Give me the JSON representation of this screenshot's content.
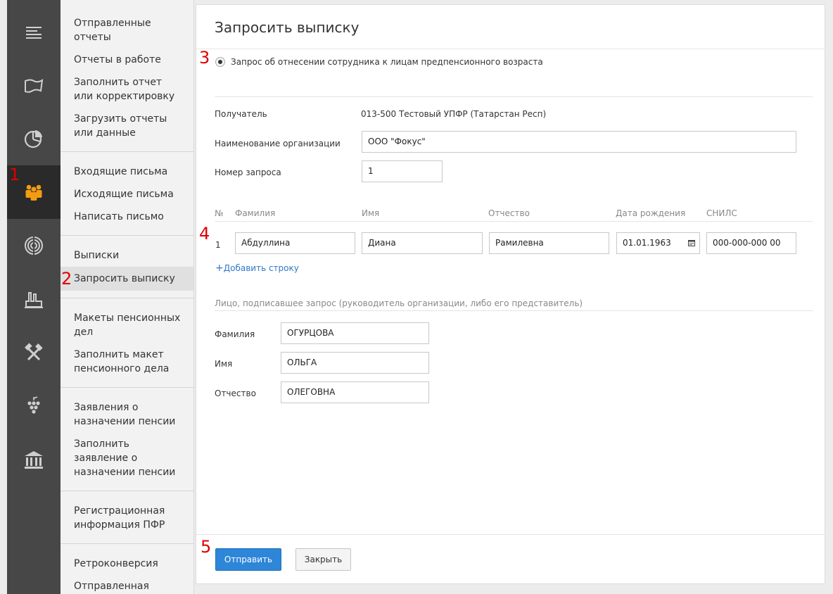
{
  "sidebar": {
    "groups": [
      {
        "items": [
          {
            "label": "Отправленные отчеты"
          },
          {
            "label": "Отчеты в работе"
          },
          {
            "label": "Заполнить отчет или корректировку"
          },
          {
            "label": "Загрузить отчеты или данные"
          }
        ]
      },
      {
        "items": [
          {
            "label": "Входящие письма"
          },
          {
            "label": "Исходящие письма"
          },
          {
            "label": "Написать письмо"
          }
        ]
      },
      {
        "items": [
          {
            "label": "Выписки"
          },
          {
            "label": "Запросить выписку"
          }
        ]
      },
      {
        "items": [
          {
            "label": "Макеты пенсионных дел"
          },
          {
            "label": "Заполнить макет пенсионного дела"
          }
        ]
      },
      {
        "items": [
          {
            "label": "Заявления о назначении пенсии"
          },
          {
            "label": "Заполнить заявление о назначении пенсии"
          }
        ]
      },
      {
        "items": [
          {
            "label": "Регистрационная информация ПФР"
          }
        ]
      },
      {
        "items": [
          {
            "label": "Ретроконверсия"
          },
          {
            "label": "Отправленная ретроконверсия"
          }
        ]
      }
    ]
  },
  "rail": {
    "icons": [
      "reports-icon",
      "mail-icon",
      "pie-chart-icon",
      "employees-icon",
      "target-icon",
      "factory-icon",
      "tools-icon",
      "grapes-icon",
      "bank-icon"
    ]
  },
  "form": {
    "title": "Запросить выписку",
    "request_type": "Запрос об отнесении сотрудника к лицам предпенсионного возраста",
    "recipient_label": "Получатель",
    "recipient_value": "013-500 Тестовый УПФР (Татарстан Респ)",
    "org_label": "Наименование организации",
    "org_value": "ООО \"Фокус\"",
    "req_num_label": "Номер запроса",
    "req_num_value": "1",
    "table": {
      "headers": {
        "num": "№",
        "last": "Фамилия",
        "first": "Имя",
        "middle": "Отчество",
        "birth": "Дата рождения",
        "snils": "СНИЛС"
      },
      "rows": [
        {
          "num": "1",
          "last": "Абдуллина",
          "first": "Диана",
          "middle": "Рамилевна",
          "birth": "01.01.1963",
          "snils": "000-000-000 00"
        }
      ]
    },
    "add_row": "Добавить строку",
    "signer_heading": "Лицо, подписавшее запрос (руководитель организации, либо его представитель)",
    "signer": {
      "last_label": "Фамилия",
      "last_value": "ОГУРЦОВА",
      "first_label": "Имя",
      "first_value": "ОЛЬГА",
      "middle_label": "Отчество",
      "middle_value": "ОЛЕГОВНА"
    },
    "send_button": "Отправить",
    "close_button": "Закрыть"
  },
  "markers": [
    "1",
    "2",
    "3",
    "4",
    "5"
  ],
  "colors": {
    "accent": "#2d86d8",
    "rail_active_icon": "#f39c12",
    "marker": "#e00000"
  }
}
